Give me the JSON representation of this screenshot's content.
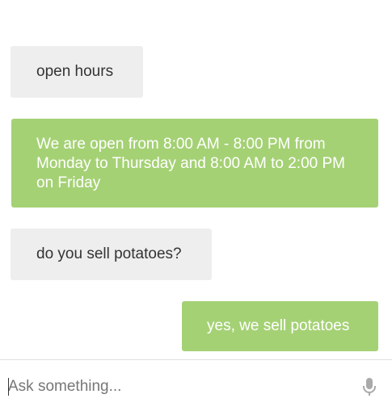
{
  "messages": [
    {
      "sender": "user",
      "text": "open hours"
    },
    {
      "sender": "bot",
      "text": "We are open from 8:00 AM - 8:00 PM from Monday to Thursday and 8:00 AM to 2:00 PM on Friday"
    },
    {
      "sender": "user",
      "text": "do you sell potatoes?"
    },
    {
      "sender": "bot",
      "text": "yes, we sell potatoes"
    }
  ],
  "input": {
    "placeholder": "Ask something...",
    "value": ""
  },
  "icons": {
    "mic": "microphone-icon"
  },
  "colors": {
    "user_bubble": "#eeeeee",
    "bot_bubble": "#a5d175",
    "mic": "#aaaaaa"
  }
}
